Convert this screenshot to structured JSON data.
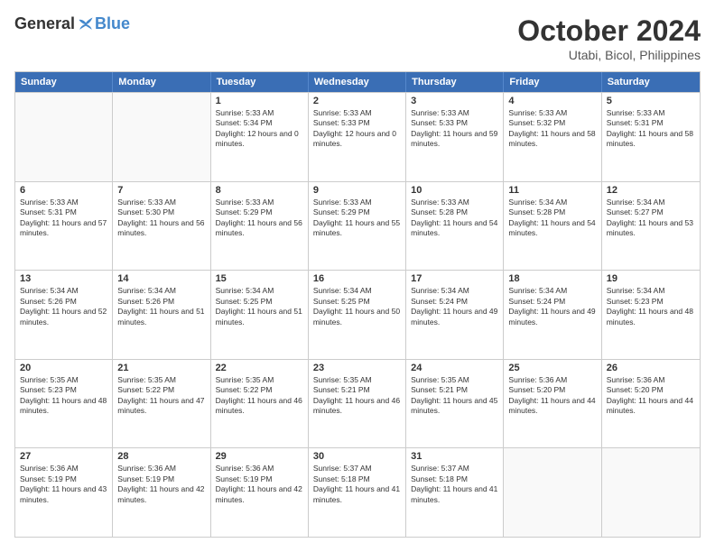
{
  "header": {
    "logo_general": "General",
    "logo_blue": "Blue",
    "month_title": "October 2024",
    "location": "Utabi, Bicol, Philippines"
  },
  "days_of_week": [
    "Sunday",
    "Monday",
    "Tuesday",
    "Wednesday",
    "Thursday",
    "Friday",
    "Saturday"
  ],
  "weeks": [
    [
      {
        "day": "",
        "empty": true
      },
      {
        "day": "",
        "empty": true
      },
      {
        "day": "1",
        "sunrise": "5:33 AM",
        "sunset": "5:34 PM",
        "daylight": "12 hours and 0 minutes."
      },
      {
        "day": "2",
        "sunrise": "5:33 AM",
        "sunset": "5:33 PM",
        "daylight": "12 hours and 0 minutes."
      },
      {
        "day": "3",
        "sunrise": "5:33 AM",
        "sunset": "5:33 PM",
        "daylight": "11 hours and 59 minutes."
      },
      {
        "day": "4",
        "sunrise": "5:33 AM",
        "sunset": "5:32 PM",
        "daylight": "11 hours and 58 minutes."
      },
      {
        "day": "5",
        "sunrise": "5:33 AM",
        "sunset": "5:31 PM",
        "daylight": "11 hours and 58 minutes."
      }
    ],
    [
      {
        "day": "6",
        "sunrise": "5:33 AM",
        "sunset": "5:31 PM",
        "daylight": "11 hours and 57 minutes."
      },
      {
        "day": "7",
        "sunrise": "5:33 AM",
        "sunset": "5:30 PM",
        "daylight": "11 hours and 56 minutes."
      },
      {
        "day": "8",
        "sunrise": "5:33 AM",
        "sunset": "5:29 PM",
        "daylight": "11 hours and 56 minutes."
      },
      {
        "day": "9",
        "sunrise": "5:33 AM",
        "sunset": "5:29 PM",
        "daylight": "11 hours and 55 minutes."
      },
      {
        "day": "10",
        "sunrise": "5:33 AM",
        "sunset": "5:28 PM",
        "daylight": "11 hours and 54 minutes."
      },
      {
        "day": "11",
        "sunrise": "5:34 AM",
        "sunset": "5:28 PM",
        "daylight": "11 hours and 54 minutes."
      },
      {
        "day": "12",
        "sunrise": "5:34 AM",
        "sunset": "5:27 PM",
        "daylight": "11 hours and 53 minutes."
      }
    ],
    [
      {
        "day": "13",
        "sunrise": "5:34 AM",
        "sunset": "5:26 PM",
        "daylight": "11 hours and 52 minutes."
      },
      {
        "day": "14",
        "sunrise": "5:34 AM",
        "sunset": "5:26 PM",
        "daylight": "11 hours and 51 minutes."
      },
      {
        "day": "15",
        "sunrise": "5:34 AM",
        "sunset": "5:25 PM",
        "daylight": "11 hours and 51 minutes."
      },
      {
        "day": "16",
        "sunrise": "5:34 AM",
        "sunset": "5:25 PM",
        "daylight": "11 hours and 50 minutes."
      },
      {
        "day": "17",
        "sunrise": "5:34 AM",
        "sunset": "5:24 PM",
        "daylight": "11 hours and 49 minutes."
      },
      {
        "day": "18",
        "sunrise": "5:34 AM",
        "sunset": "5:24 PM",
        "daylight": "11 hours and 49 minutes."
      },
      {
        "day": "19",
        "sunrise": "5:34 AM",
        "sunset": "5:23 PM",
        "daylight": "11 hours and 48 minutes."
      }
    ],
    [
      {
        "day": "20",
        "sunrise": "5:35 AM",
        "sunset": "5:23 PM",
        "daylight": "11 hours and 48 minutes."
      },
      {
        "day": "21",
        "sunrise": "5:35 AM",
        "sunset": "5:22 PM",
        "daylight": "11 hours and 47 minutes."
      },
      {
        "day": "22",
        "sunrise": "5:35 AM",
        "sunset": "5:22 PM",
        "daylight": "11 hours and 46 minutes."
      },
      {
        "day": "23",
        "sunrise": "5:35 AM",
        "sunset": "5:21 PM",
        "daylight": "11 hours and 46 minutes."
      },
      {
        "day": "24",
        "sunrise": "5:35 AM",
        "sunset": "5:21 PM",
        "daylight": "11 hours and 45 minutes."
      },
      {
        "day": "25",
        "sunrise": "5:36 AM",
        "sunset": "5:20 PM",
        "daylight": "11 hours and 44 minutes."
      },
      {
        "day": "26",
        "sunrise": "5:36 AM",
        "sunset": "5:20 PM",
        "daylight": "11 hours and 44 minutes."
      }
    ],
    [
      {
        "day": "27",
        "sunrise": "5:36 AM",
        "sunset": "5:19 PM",
        "daylight": "11 hours and 43 minutes."
      },
      {
        "day": "28",
        "sunrise": "5:36 AM",
        "sunset": "5:19 PM",
        "daylight": "11 hours and 42 minutes."
      },
      {
        "day": "29",
        "sunrise": "5:36 AM",
        "sunset": "5:19 PM",
        "daylight": "11 hours and 42 minutes."
      },
      {
        "day": "30",
        "sunrise": "5:37 AM",
        "sunset": "5:18 PM",
        "daylight": "11 hours and 41 minutes."
      },
      {
        "day": "31",
        "sunrise": "5:37 AM",
        "sunset": "5:18 PM",
        "daylight": "11 hours and 41 minutes."
      },
      {
        "day": "",
        "empty": true
      },
      {
        "day": "",
        "empty": true
      }
    ]
  ]
}
